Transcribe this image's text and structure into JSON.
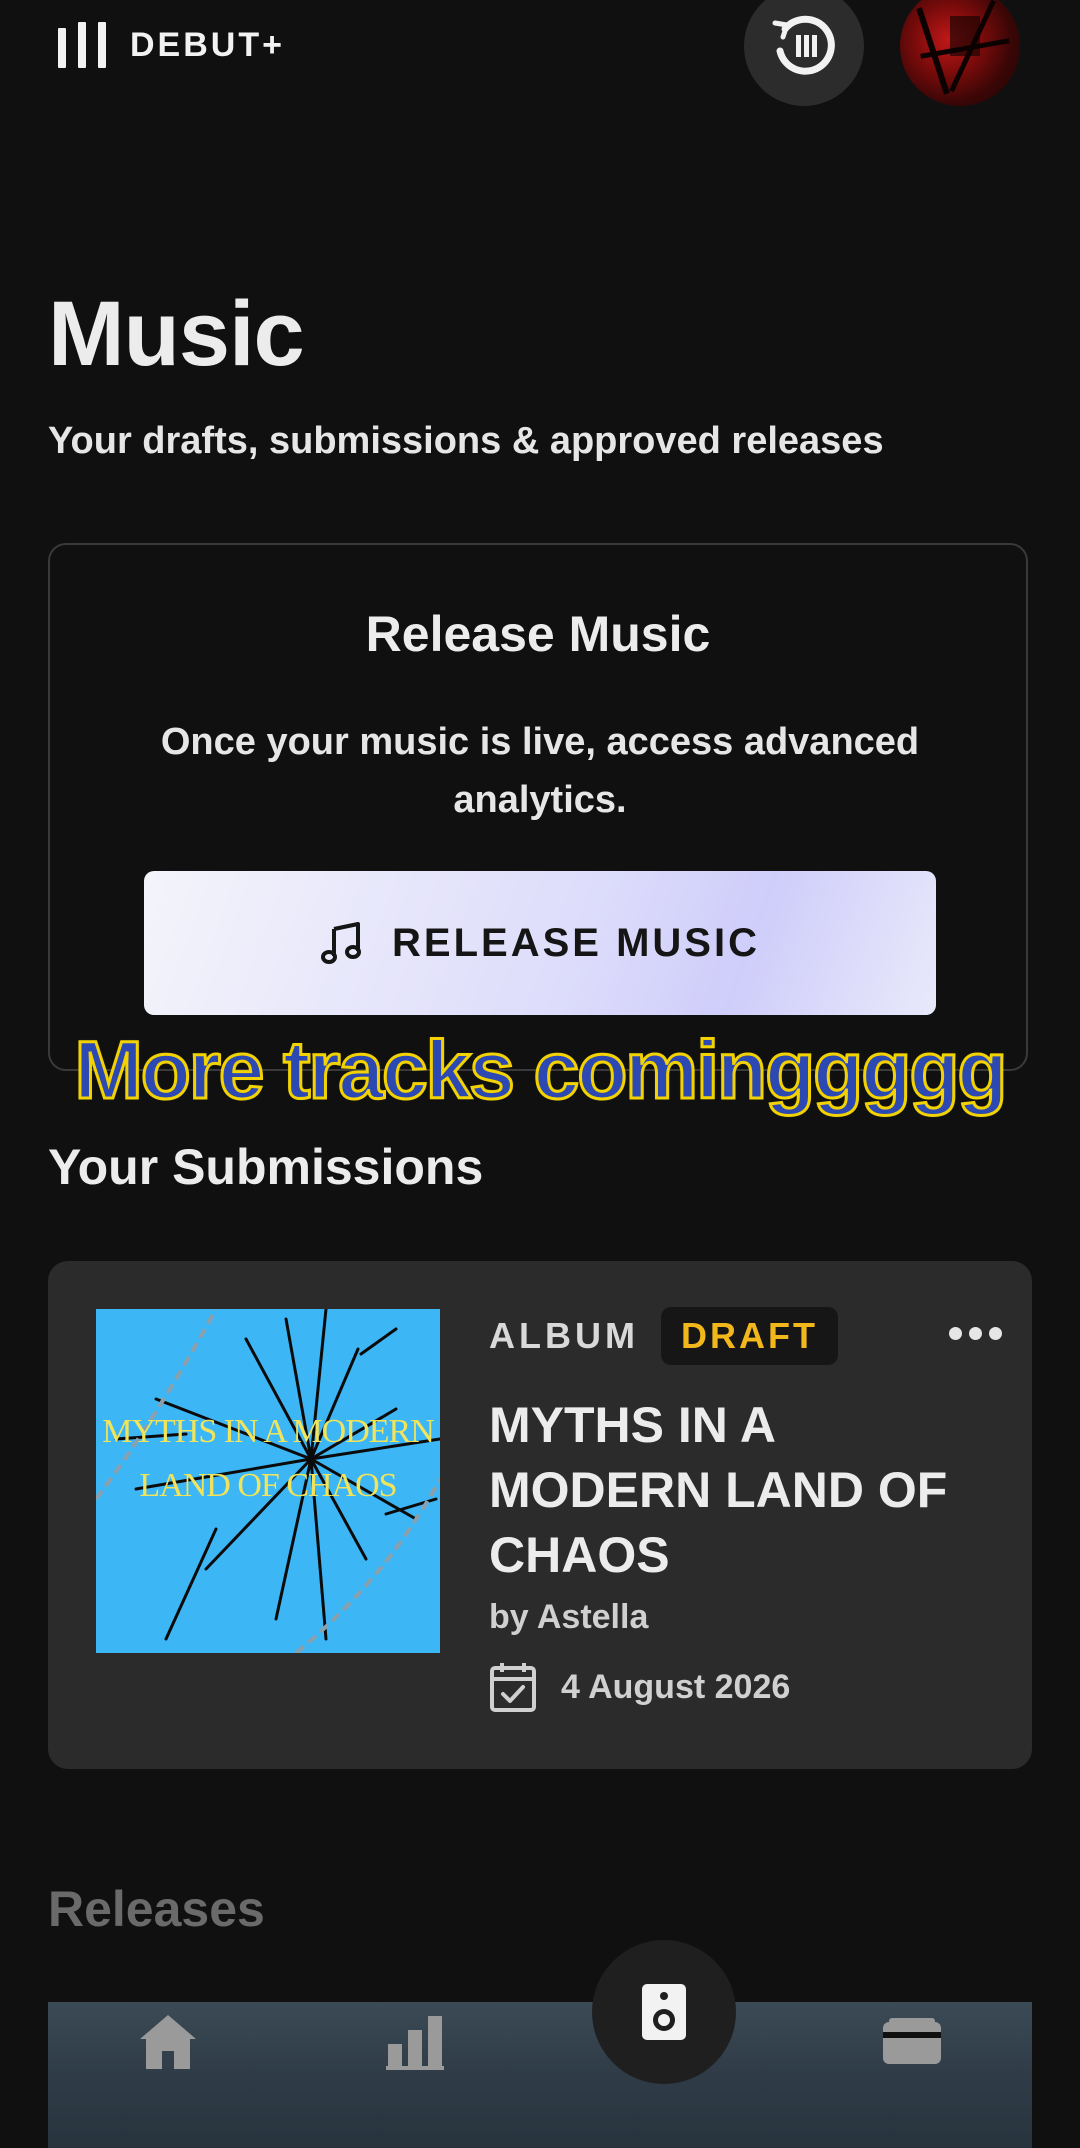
{
  "app": {
    "brand": "DEBUT+",
    "icons": {
      "brand": "bars-logo-icon",
      "history": "history-icon",
      "avatar": "profile-avatar"
    }
  },
  "header": {
    "title": "Music",
    "subtitle": "Your drafts, submissions & approved releases"
  },
  "release_card": {
    "title": "Release Music",
    "description": "Once your music is live, access advanced analytics.",
    "button_label": "RELEASE MUSIC",
    "button_icon": "music-note-icon"
  },
  "overlay_caption": "More tracks cominggggg",
  "submissions": {
    "section_title": "Your Submissions",
    "items": [
      {
        "cover_text": "MYTHS IN A MODERN LAND OF CHAOS",
        "type": "ALBUM",
        "status": "DRAFT",
        "title": "MYTHS IN A MODERN LAND OF CHAOS",
        "artist": "by Astella",
        "date": "4 August 2026",
        "date_icon": "calendar-check-icon"
      }
    ]
  },
  "releases": {
    "section_title": "Releases"
  },
  "bottom_nav": {
    "items": [
      "home-icon",
      "stats-icon",
      "speaker-icon",
      "wallet-icon"
    ],
    "active": "speaker-icon"
  },
  "colors": {
    "background": "#101011",
    "card": "#2b2b2c",
    "accent_button": "#dddcfb",
    "draft_badge": "#f2b81b",
    "caption_fill": "#2c48b2",
    "caption_stroke": "#f2d200"
  }
}
